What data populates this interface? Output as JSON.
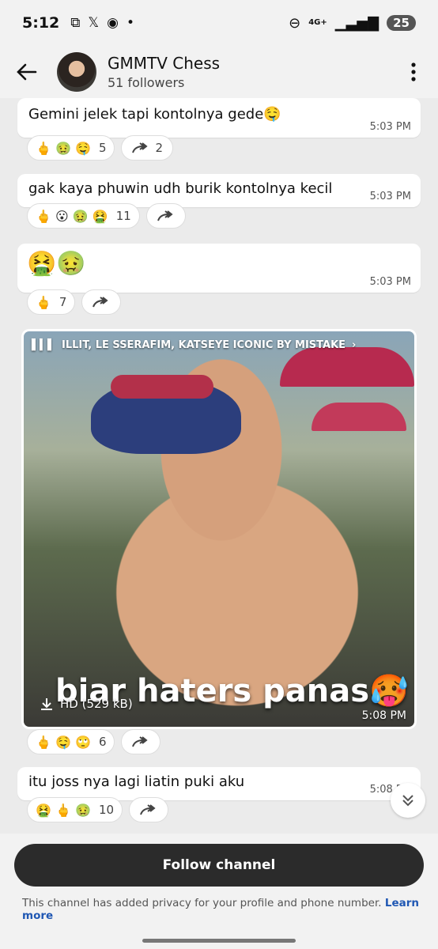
{
  "status_bar": {
    "time": "5:12",
    "left_icons": [
      "screenshot-icon",
      "x-icon",
      "target-icon",
      "dot"
    ],
    "network": "4G+",
    "battery": "25"
  },
  "header": {
    "channel_name": "GMMTV Chess",
    "followers": "51 followers"
  },
  "messages": [
    {
      "text": "Gemini jelek tapi kontolnya gede🤤",
      "time": "5:03 PM",
      "reactions": "🖕 🤢 🤤",
      "reaction_count": "5",
      "forward_count": "2"
    },
    {
      "text": "gak kaya phuwin udh burik kontolnya kecil",
      "time": "5:03 PM",
      "reactions": "🖕 😮 🤢 🤮",
      "reaction_count": "11",
      "forward_count": ""
    },
    {
      "text": "🤮🤢",
      "time": "5:03 PM",
      "reactions": "🖕",
      "reaction_count": "7",
      "forward_count": ""
    },
    {
      "music": "ILLIT, LE SSERAFIM, KATSEYE ICONIC BY MISTAKE",
      "caption": "biar haters panas🥵",
      "download": "HD (529 kB)",
      "time": "5:08 PM",
      "reactions": "🖕 🤤 🙄",
      "reaction_count": "6",
      "forward_count": ""
    },
    {
      "text": "itu joss nya lagi liatin puki aku",
      "time": "5:08 PM",
      "reactions": "🤮 🖕 🤢",
      "reaction_count": "10",
      "forward_count": ""
    }
  ],
  "footer": {
    "follow_label": "Follow channel",
    "privacy_text": "This channel has added privacy for your profile and phone number.",
    "learn_more": "Learn more"
  }
}
